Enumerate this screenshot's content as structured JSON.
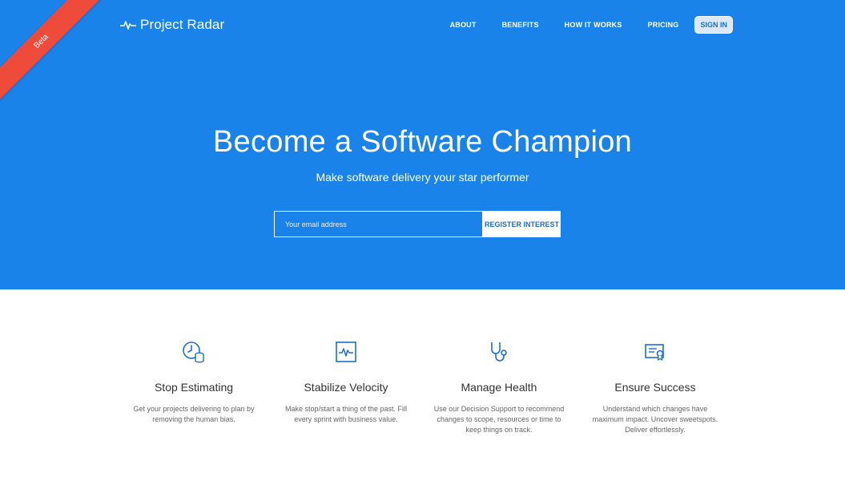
{
  "ribbon": {
    "label": "Beta"
  },
  "brand": {
    "name": "Project Radar",
    "icon": "pulse-icon"
  },
  "nav": {
    "items": [
      {
        "label": "ABOUT"
      },
      {
        "label": "BENEFITS"
      },
      {
        "label": "HOW IT WORKS"
      },
      {
        "label": "PRICING"
      }
    ],
    "signin_label": "SIGN IN"
  },
  "hero": {
    "title": "Become a Software Champion",
    "subtitle": "Make software delivery your star performer",
    "email_placeholder": "Your email address",
    "register_label": "REGISTER INTEREST"
  },
  "features": [
    {
      "icon": "clock-coins-icon",
      "title": "Stop Estimating",
      "description": "Get your projects delivering to plan by removing the human bias."
    },
    {
      "icon": "velocity-chart-icon",
      "title": "Stabilize Velocity",
      "description": "Make stop/start a thing of the past. Fill every sprint with business value."
    },
    {
      "icon": "stethoscope-icon",
      "title": "Manage Health",
      "description": "Use our Decision Support to recommend changes to scope, resources or time to keep things on track."
    },
    {
      "icon": "certificate-icon",
      "title": "Ensure Success",
      "description": "Understand which changes have maximum impact. Uncover sweetspots. Deliver effortlessly."
    }
  ],
  "colors": {
    "hero_bg": "#1a83ea",
    "ribbon": "#ee4b3a",
    "accent": "#1a6fd0",
    "text": "#333333"
  }
}
